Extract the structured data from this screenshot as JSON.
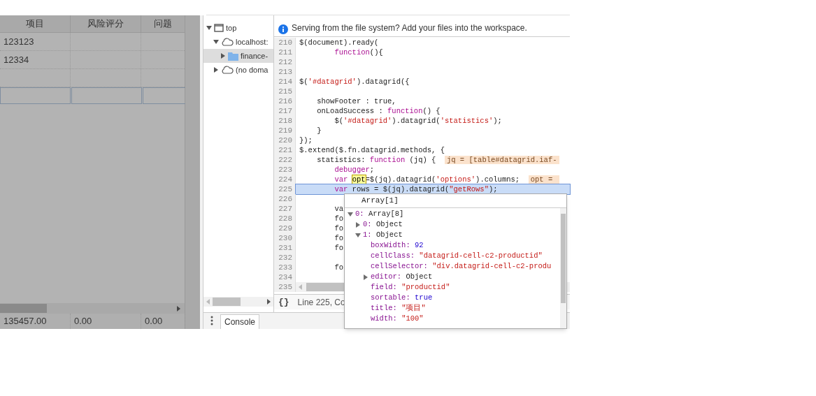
{
  "datagrid": {
    "columns": [
      "项目",
      "风险评分",
      "问题"
    ],
    "rows": [
      {
        "cells": [
          "123123"
        ]
      },
      {
        "cells": [
          "12334"
        ]
      }
    ],
    "footer": [
      "135457.00",
      "0.00",
      "0.00"
    ]
  },
  "file_tree": [
    {
      "label": "top",
      "kind": "window",
      "expanded": true,
      "selected": false,
      "children": [
        {
          "label": "localhost:",
          "kind": "cloud",
          "expanded": true,
          "selected": false,
          "children": [
            {
              "label": "finance-",
              "kind": "folder",
              "expanded": false,
              "selected": true
            }
          ]
        },
        {
          "label": "(no doma",
          "kind": "cloud",
          "expanded": false,
          "selected": false
        }
      ]
    }
  ],
  "infobar": "Serving from the file system? Add your files into the workspace.",
  "code": [
    {
      "number": "210",
      "current": false,
      "segments": [
        {
          "kind": "plain",
          "text": "$(document).ready("
        }
      ]
    },
    {
      "number": "211",
      "current": false,
      "segments": [
        {
          "kind": "keyword",
          "text": "        function"
        },
        {
          "kind": "plain",
          "text": "(){"
        }
      ]
    },
    {
      "number": "212",
      "current": false
    },
    {
      "number": "213",
      "current": false
    },
    {
      "number": "214",
      "current": false,
      "segments": [
        {
          "kind": "plain",
          "text": "$("
        },
        {
          "kind": "string",
          "text": "'#datagrid'"
        },
        {
          "kind": "plain",
          "text": ").datagrid({"
        }
      ]
    },
    {
      "number": "215",
      "current": false
    },
    {
      "number": "216",
      "current": false,
      "segments": [
        {
          "kind": "plain",
          "text": "    showFooter : true,"
        }
      ]
    },
    {
      "number": "217",
      "current": false,
      "segments": [
        {
          "kind": "plain",
          "text": "    onLoadSuccess : "
        },
        {
          "kind": "keyword",
          "text": "function"
        },
        {
          "kind": "plain",
          "text": "() {"
        }
      ]
    },
    {
      "number": "218",
      "current": false,
      "segments": [
        {
          "kind": "plain",
          "text": "        $("
        },
        {
          "kind": "string",
          "text": "'#datagrid'"
        },
        {
          "kind": "plain",
          "text": ").datagrid("
        },
        {
          "kind": "string",
          "text": "'statistics'"
        },
        {
          "kind": "plain",
          "text": ");"
        }
      ]
    },
    {
      "number": "219",
      "current": false,
      "segments": [
        {
          "kind": "plain",
          "text": "    }"
        }
      ]
    },
    {
      "number": "220",
      "current": false,
      "segments": [
        {
          "kind": "plain",
          "text": "});"
        }
      ]
    },
    {
      "number": "221",
      "current": false,
      "segments": [
        {
          "kind": "plain",
          "text": "$.extend($.fn.datagrid.methods, {"
        }
      ]
    },
    {
      "number": "222",
      "current": false,
      "segments": [
        {
          "kind": "plain",
          "text": "    statistics: "
        },
        {
          "kind": "keyword",
          "text": "function"
        },
        {
          "kind": "plain",
          "text": " (jq) {  "
        },
        {
          "kind": "inline_value",
          "text": "jq = [table#datagrid.iaf-"
        }
      ]
    },
    {
      "number": "223",
      "current": false,
      "segments": [
        {
          "kind": "keyword",
          "text": "        debugger"
        },
        {
          "kind": "plain",
          "text": ";"
        }
      ]
    },
    {
      "number": "224",
      "current": false,
      "segments": [
        {
          "kind": "keyword",
          "text": "        var "
        },
        {
          "kind": "hover",
          "text": "opt"
        },
        {
          "kind": "plain",
          "text": "=$(jq).datagrid("
        },
        {
          "kind": "string",
          "text": "'options'"
        },
        {
          "kind": "plain",
          "text": ").columns;  "
        },
        {
          "kind": "inline_value",
          "text": "opt = "
        }
      ]
    },
    {
      "number": "225",
      "current": true,
      "segments": [
        {
          "kind": "keyword",
          "text": "        var"
        },
        {
          "kind": "plain",
          "text": " rows = $(jq).datagrid("
        },
        {
          "kind": "string",
          "text": "\"getRows\""
        },
        {
          "kind": "plain",
          "text": ");"
        }
      ]
    },
    {
      "number": "226",
      "current": false
    },
    {
      "number": "227",
      "current": false,
      "segments": [
        {
          "kind": "plain",
          "text": "        va"
        }
      ]
    },
    {
      "number": "228",
      "current": false,
      "segments": [
        {
          "kind": "plain",
          "text": "        fo"
        }
      ]
    },
    {
      "number": "229",
      "current": false,
      "segments": [
        {
          "kind": "plain",
          "text": "        fo"
        }
      ]
    },
    {
      "number": "230",
      "current": false,
      "segments": [
        {
          "kind": "plain",
          "text": "        fo"
        }
      ]
    },
    {
      "number": "231",
      "current": false,
      "segments": [
        {
          "kind": "plain",
          "text": "        fo"
        }
      ]
    },
    {
      "number": "232",
      "current": false
    },
    {
      "number": "233",
      "current": false,
      "segments": [
        {
          "kind": "plain",
          "text": "        fo"
        }
      ]
    },
    {
      "number": "234",
      "current": false
    }
  ],
  "last_line_number": "235",
  "status": {
    "format_button": "{}",
    "position": "Line 225, Co"
  },
  "popover": {
    "title": "Array[1]",
    "tree": [
      {
        "key": "0:",
        "value": "Array[8]",
        "kind": "object",
        "expanded": true,
        "children": [
          {
            "key": "0:",
            "value": "Object",
            "kind": "object",
            "expanded": false
          },
          {
            "key": "1:",
            "value": "Object",
            "kind": "object",
            "expanded": true,
            "children": [
              {
                "key": "boxWidth:",
                "value": "92",
                "kind": "number"
              },
              {
                "key": "cellClass:",
                "value": "\"datagrid-cell-c2-productid\"",
                "kind": "string"
              },
              {
                "key": "cellSelector:",
                "value": "\"div.datagrid-cell-c2-produ",
                "kind": "string"
              },
              {
                "key": "editor:",
                "value": "Object",
                "kind": "object",
                "expanded": false
              },
              {
                "key": "field:",
                "value": "\"productid\"",
                "kind": "string"
              },
              {
                "key": "sortable:",
                "value": "true",
                "kind": "number"
              },
              {
                "key": "title:",
                "value": "\"项目\"",
                "kind": "string"
              },
              {
                "key": "width:",
                "value": "\"100\"",
                "kind": "string"
              }
            ]
          }
        ]
      }
    ]
  },
  "drawer_tabs": [
    {
      "label": "Console",
      "selected": true
    }
  ]
}
